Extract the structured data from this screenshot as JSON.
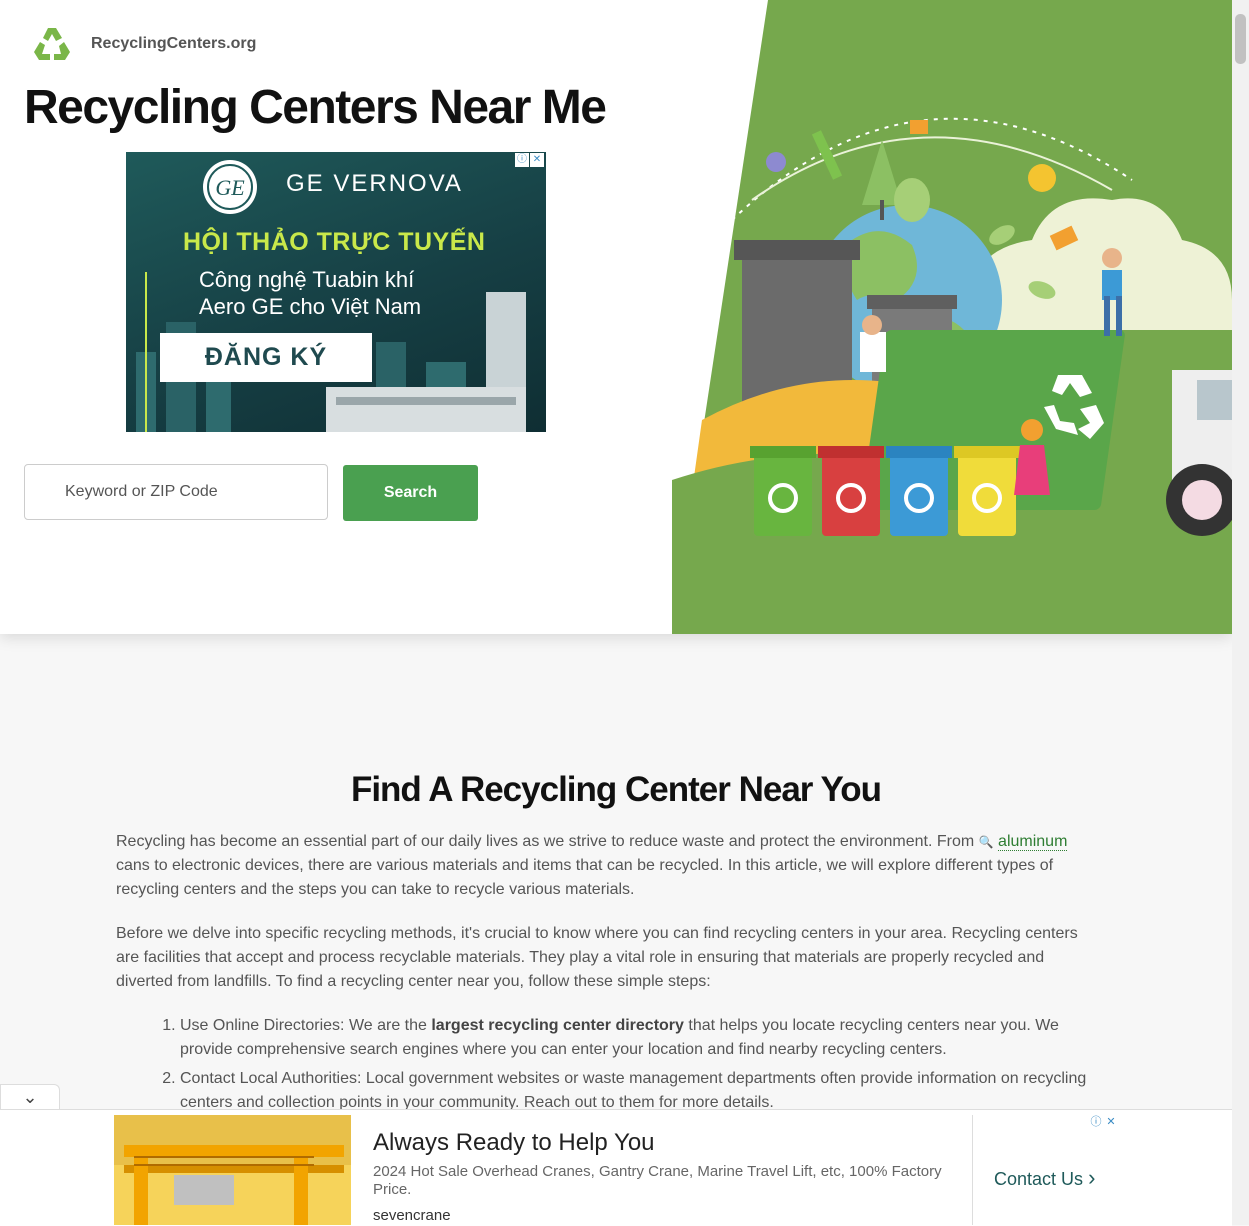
{
  "site": {
    "name": "RecyclingCenters.org"
  },
  "hero": {
    "title": "Recycling Centers Near Me",
    "search": {
      "placeholder": "Keyword or ZIP Code",
      "button_label": "Search"
    }
  },
  "ad_top": {
    "brand": "GE VERNOVA",
    "logo_text": "GE",
    "headline": "HỘI THẢO TRỰC TUYẾN",
    "subline1": "Công nghệ Tuabin khí",
    "subline2": "Aero GE cho Việt Nam",
    "cta": "ĐĂNG KÝ",
    "info_icon": "ⓘ",
    "close_icon": "✕"
  },
  "article": {
    "title": "Find A Recycling Center Near You",
    "p1_start": "Recycling has become an essential part of our daily lives as we strive to reduce waste and protect the environment. From ",
    "p1_keyword": "aluminum",
    "p1_end": " cans to electronic devices, there are various materials and items that can be recycled. In this article, we will explore different types of recycling centers and the steps you can take to recycle various materials.",
    "p2": "Before we delve into specific recycling methods, it's crucial to know where you can find recycling centers in your area. Recycling centers are facilities that accept and process recyclable materials. They play a vital role in ensuring that materials are properly recycled and diverted from landfills. To find a recycling center near you, follow these simple steps:",
    "steps": [
      {
        "start": "Use Online Directories: We are the ",
        "bold": "largest recycling center directory",
        "end": " that helps you locate recycling centers near you. We provide comprehensive search engines where you can enter your location and find nearby recycling centers."
      },
      {
        "start": "Contact Local Authorities: Local government websites or waste management departments often provide information on recycling centers and collection points in your community. Reach out to them for more details.",
        "bold": "",
        "end": ""
      }
    ]
  },
  "bottom_ad": {
    "title": "Always Ready to Help You",
    "description": "2024 Hot Sale Overhead Cranes, Gantry Crane, Marine Travel Lift, etc, 100% Factory Price.",
    "advertiser": "sevencrane",
    "cta": "Contact Us",
    "info_icon": "ⓘ",
    "close_icon": "✕"
  },
  "colors": {
    "brand_green": "#4aa050",
    "hero_green": "#76a84d",
    "ad_accent": "#c9e84a"
  }
}
